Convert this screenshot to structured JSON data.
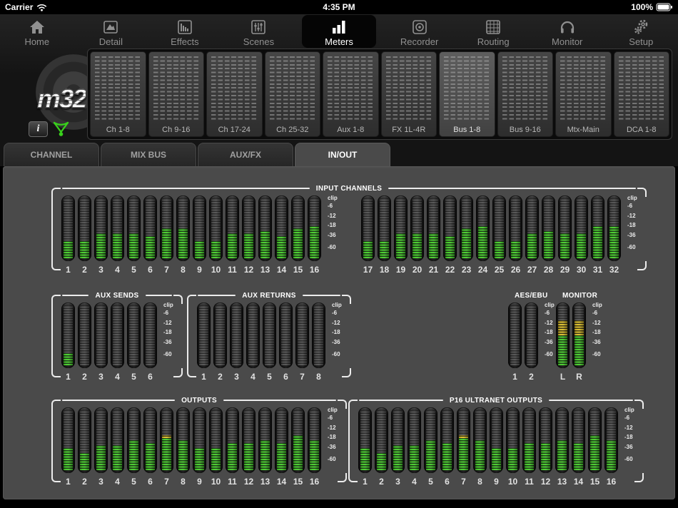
{
  "status_bar": {
    "carrier": "Carrier",
    "time": "4:35 PM",
    "battery": "100%"
  },
  "logo": {
    "text": "m32"
  },
  "info_button": {
    "label": "i"
  },
  "colors": {
    "meter_green": "#3fca22",
    "meter_yellow": "#d9bb20",
    "connection_green": "#39d01c"
  },
  "nav": {
    "items": [
      {
        "label": "Home",
        "icon": "home",
        "selected": false
      },
      {
        "label": "Detail",
        "icon": "detail",
        "selected": false
      },
      {
        "label": "Effects",
        "icon": "effects",
        "selected": false
      },
      {
        "label": "Scenes",
        "icon": "scenes",
        "selected": false
      },
      {
        "label": "Meters",
        "icon": "meters",
        "selected": true
      },
      {
        "label": "Recorder",
        "icon": "recorder",
        "selected": false
      },
      {
        "label": "Routing",
        "icon": "routing",
        "selected": false
      },
      {
        "label": "Monitor",
        "icon": "monitor",
        "selected": false
      },
      {
        "label": "Setup",
        "icon": "setup",
        "selected": false
      }
    ]
  },
  "banks": {
    "items": [
      {
        "label": "Ch 1-8",
        "selected": false
      },
      {
        "label": "Ch 9-16",
        "selected": false
      },
      {
        "label": "Ch 17-24",
        "selected": false
      },
      {
        "label": "Ch 25-32",
        "selected": false
      },
      {
        "label": "Aux 1-8",
        "selected": false
      },
      {
        "label": "FX 1L-4R",
        "selected": false
      },
      {
        "label": "Bus 1-8",
        "selected": true
      },
      {
        "label": "Bus 9-16",
        "selected": false
      },
      {
        "label": "Mtx-Main",
        "selected": false
      },
      {
        "label": "DCA 1-8",
        "selected": false
      }
    ]
  },
  "tabs": {
    "items": [
      {
        "label": "CHANNEL",
        "selected": false
      },
      {
        "label": "MIX BUS",
        "selected": false
      },
      {
        "label": "AUX/FX",
        "selected": false
      },
      {
        "label": "IN/OUT",
        "selected": true
      }
    ]
  },
  "scale": {
    "labels": [
      "clip",
      "-6",
      "-12",
      "-18",
      "-36",
      "-60"
    ]
  },
  "sections": [
    {
      "id": "input-channels",
      "title": "INPUT CHANNELS",
      "groups": [
        {
          "channels": [
            "1",
            "2",
            "3",
            "4",
            "5",
            "6",
            "7",
            "8",
            "9",
            "10",
            "11",
            "12",
            "13",
            "14",
            "15",
            "16"
          ],
          "levels": [
            [
              0.3
            ],
            [
              0.3
            ],
            [
              0.43
            ],
            [
              0.43
            ],
            [
              0.43
            ],
            [
              0.38
            ],
            [
              0.5
            ],
            [
              0.52
            ],
            [
              0.31
            ],
            [
              0.31
            ],
            [
              0.43
            ],
            [
              0.43
            ],
            [
              0.44
            ],
            [
              0.38
            ],
            [
              0.52
            ],
            [
              0.53
            ]
          ]
        },
        {
          "channels": [
            "17",
            "18",
            "19",
            "20",
            "21",
            "22",
            "23",
            "24",
            "25",
            "26",
            "27",
            "28",
            "29",
            "30",
            "31",
            "32"
          ],
          "levels": [
            [
              0.3
            ],
            [
              0.28
            ],
            [
              0.42
            ],
            [
              0.43
            ],
            [
              0.43
            ],
            [
              0.38
            ],
            [
              0.52
            ],
            [
              0.53
            ],
            [
              0.31
            ],
            [
              0.31
            ],
            [
              0.43
            ],
            [
              0.44
            ],
            [
              0.43
            ],
            [
              0.4
            ],
            [
              0.53
            ],
            [
              0.55
            ]
          ]
        }
      ]
    },
    {
      "id": "aux-sends",
      "title": "AUX SENDS",
      "groups": [
        {
          "channels": [
            "1",
            "2",
            "3",
            "4",
            "5",
            "6"
          ],
          "levels": [
            [
              0.22
            ],
            [
              0
            ],
            [
              0
            ],
            [
              0
            ],
            [
              0
            ],
            [
              0
            ]
          ]
        }
      ]
    },
    {
      "id": "aux-returns",
      "title": "AUX RETURNS",
      "groups": [
        {
          "channels": [
            "1",
            "2",
            "3",
            "4",
            "5",
            "6",
            "7",
            "8"
          ],
          "levels": [
            [
              0
            ],
            [
              0
            ],
            [
              0
            ],
            [
              0
            ],
            [
              0
            ],
            [
              0
            ],
            [
              0
            ],
            [
              0
            ]
          ]
        }
      ]
    },
    {
      "id": "aes-ebu",
      "title": "AES/EBU",
      "groups": [
        {
          "channels": [
            "1",
            "2"
          ],
          "levels": [
            [
              0
            ],
            [
              0
            ]
          ]
        }
      ]
    },
    {
      "id": "monitor",
      "title": "MONITOR",
      "groups": [
        {
          "channels": [
            "L",
            "R"
          ],
          "levels": [
            [
              0.5,
              0.73
            ],
            [
              0.5,
              0.73
            ]
          ]
        }
      ]
    },
    {
      "id": "outputs",
      "title": "OUTPUTS",
      "groups": [
        {
          "channels": [
            "1",
            "2",
            "3",
            "4",
            "5",
            "6",
            "7",
            "8",
            "9",
            "10",
            "11",
            "12",
            "13",
            "14",
            "15",
            "16"
          ],
          "levels": [
            [
              0.36
            ],
            [
              0.3
            ],
            [
              0.43
            ],
            [
              0.43
            ],
            [
              0.48
            ],
            [
              0.44
            ],
            [
              0.56,
              0.58
            ],
            [
              0.52
            ],
            [
              0.36
            ],
            [
              0.37
            ],
            [
              0.44
            ],
            [
              0.44
            ],
            [
              0.5
            ],
            [
              0.45
            ],
            [
              0.58,
              0.6
            ],
            [
              0.52
            ]
          ]
        }
      ]
    },
    {
      "id": "p16-ultranet",
      "title": "P16 ULTRANET OUTPUTS",
      "groups": [
        {
          "channels": [
            "1",
            "2",
            "3",
            "4",
            "5",
            "6",
            "7",
            "8",
            "9",
            "10",
            "11",
            "12",
            "13",
            "14",
            "15",
            "16"
          ],
          "levels": [
            [
              0.36
            ],
            [
              0.3
            ],
            [
              0.43
            ],
            [
              0.43
            ],
            [
              0.48
            ],
            [
              0.44
            ],
            [
              0.56,
              0.58
            ],
            [
              0.52
            ],
            [
              0.36
            ],
            [
              0.37
            ],
            [
              0.44
            ],
            [
              0.44
            ],
            [
              0.5
            ],
            [
              0.45
            ],
            [
              0.58,
              0.6
            ],
            [
              0.52
            ]
          ]
        }
      ]
    }
  ]
}
